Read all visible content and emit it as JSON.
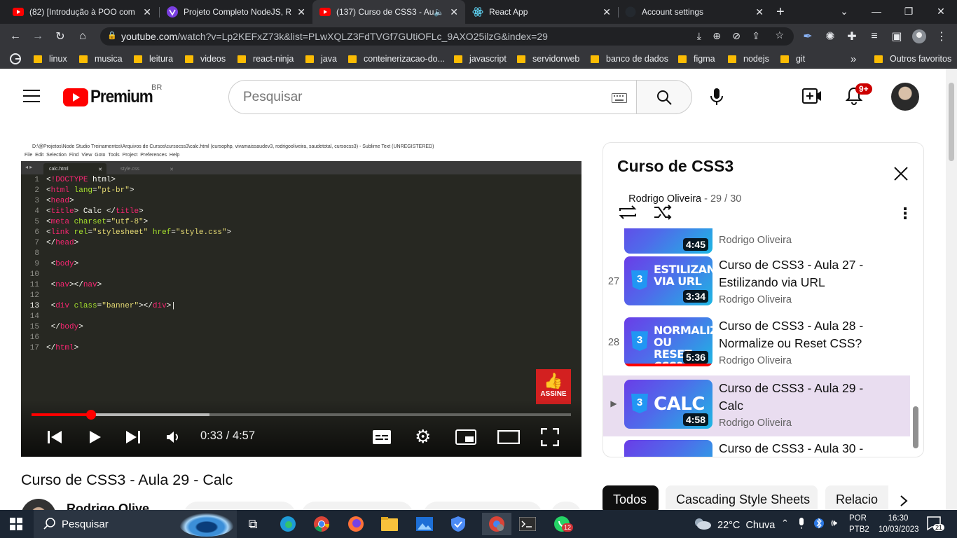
{
  "browser": {
    "tabs": [
      {
        "title": "(82) [Introdução à POO com",
        "active": false
      },
      {
        "title": "Projeto Completo NodeJS, R",
        "active": false
      },
      {
        "title": "(137) Curso de CSS3 - Au",
        "active": true
      },
      {
        "title": "React App",
        "active": false
      },
      {
        "title": "Account settings",
        "active": false
      }
    ],
    "url_domain": "youtube.com",
    "url_path": "/watch?v=Lp2KEFxZ73k&list=PLwXQLZ3FdTVGf7GUtiOFLc_9AXO25ilzG&index=29",
    "bookmarks": [
      "linux",
      "musica",
      "leitura",
      "videos",
      "react-ninja",
      "java",
      "conteinerizacao-do...",
      "javascript",
      "servidorweb",
      "banco de dados",
      "figma",
      "nodejs",
      "git"
    ],
    "bookmarks_more": "»",
    "other_bookmarks": "Outros favoritos"
  },
  "youtube": {
    "logo_text": "Premium",
    "country": "BR",
    "search_placeholder": "Pesquisar",
    "notifications_badge": "9+"
  },
  "player": {
    "window_title": "D:\\@Projetos\\Node Studio Treinamentos\\Arquivos de Cursos\\cursocss3\\calc.html (cursophp, vivamaissaudev3, rodrigooliveira, saudetotal, cursocss3) - Sublime Text (UNREGISTERED)",
    "menu": [
      "File",
      "Edit",
      "Selection",
      "Find",
      "View",
      "Goto",
      "Tools",
      "Project",
      "Preferences",
      "Help"
    ],
    "file_tabs": [
      "calc.html",
      "style.css"
    ],
    "line_numbers": [
      "1",
      "2",
      "3",
      "4",
      "5",
      "6",
      "7",
      "8",
      "9",
      "10",
      "11",
      "12",
      "13",
      "14",
      "15",
      "16",
      "17"
    ],
    "subscribe_label": "ASSINE",
    "time_current": "0:33",
    "time_sep": " / ",
    "time_total": "4:57",
    "progress_fraction": 0.11,
    "buffered_fraction": 0.33
  },
  "video": {
    "title": "Curso de CSS3 - Aula 29 - Calc",
    "channel": "Rodrigo Olive..."
  },
  "playlist": {
    "title": "Curso de CSS3",
    "owner": "Rodrigo Oliveira",
    "position": "29 / 30",
    "items": [
      {
        "index": "",
        "thumb_text": "",
        "duration": "4:45",
        "title": "",
        "channel": "Rodrigo Oliveira"
      },
      {
        "index": "27",
        "thumb_text": "ESTILIZANDO VIA URL",
        "duration": "3:34",
        "title": "Curso de CSS3 - Aula 27 - Estilizando via URL",
        "channel": "Rodrigo Oliveira"
      },
      {
        "index": "28",
        "thumb_text": "NORMALIZE OU RESET CSS?",
        "duration": "5:36",
        "title": "Curso de CSS3 - Aula 28 - Normalize ou Reset CSS?",
        "channel": "Rodrigo Oliveira"
      },
      {
        "index": "▶",
        "thumb_text": "CALC",
        "duration": "4:58",
        "title": "Curso de CSS3 - Aula 29 - Calc",
        "channel": "Rodrigo Oliveira"
      },
      {
        "index": "",
        "thumb_text": "",
        "duration": "",
        "title": "Curso de CSS3 - Aula 30 -",
        "channel": ""
      }
    ]
  },
  "chips": [
    "Todos",
    "Cascading Style Sheets",
    "Relacio"
  ],
  "taskbar": {
    "search_placeholder": "Pesquisar",
    "whatsapp_badge": "12",
    "weather": "22°C  Chuva",
    "lang_top": "POR",
    "lang_bottom": "PTB2",
    "time": "16:30",
    "date": "10/03/2023",
    "notif_count": "21"
  }
}
